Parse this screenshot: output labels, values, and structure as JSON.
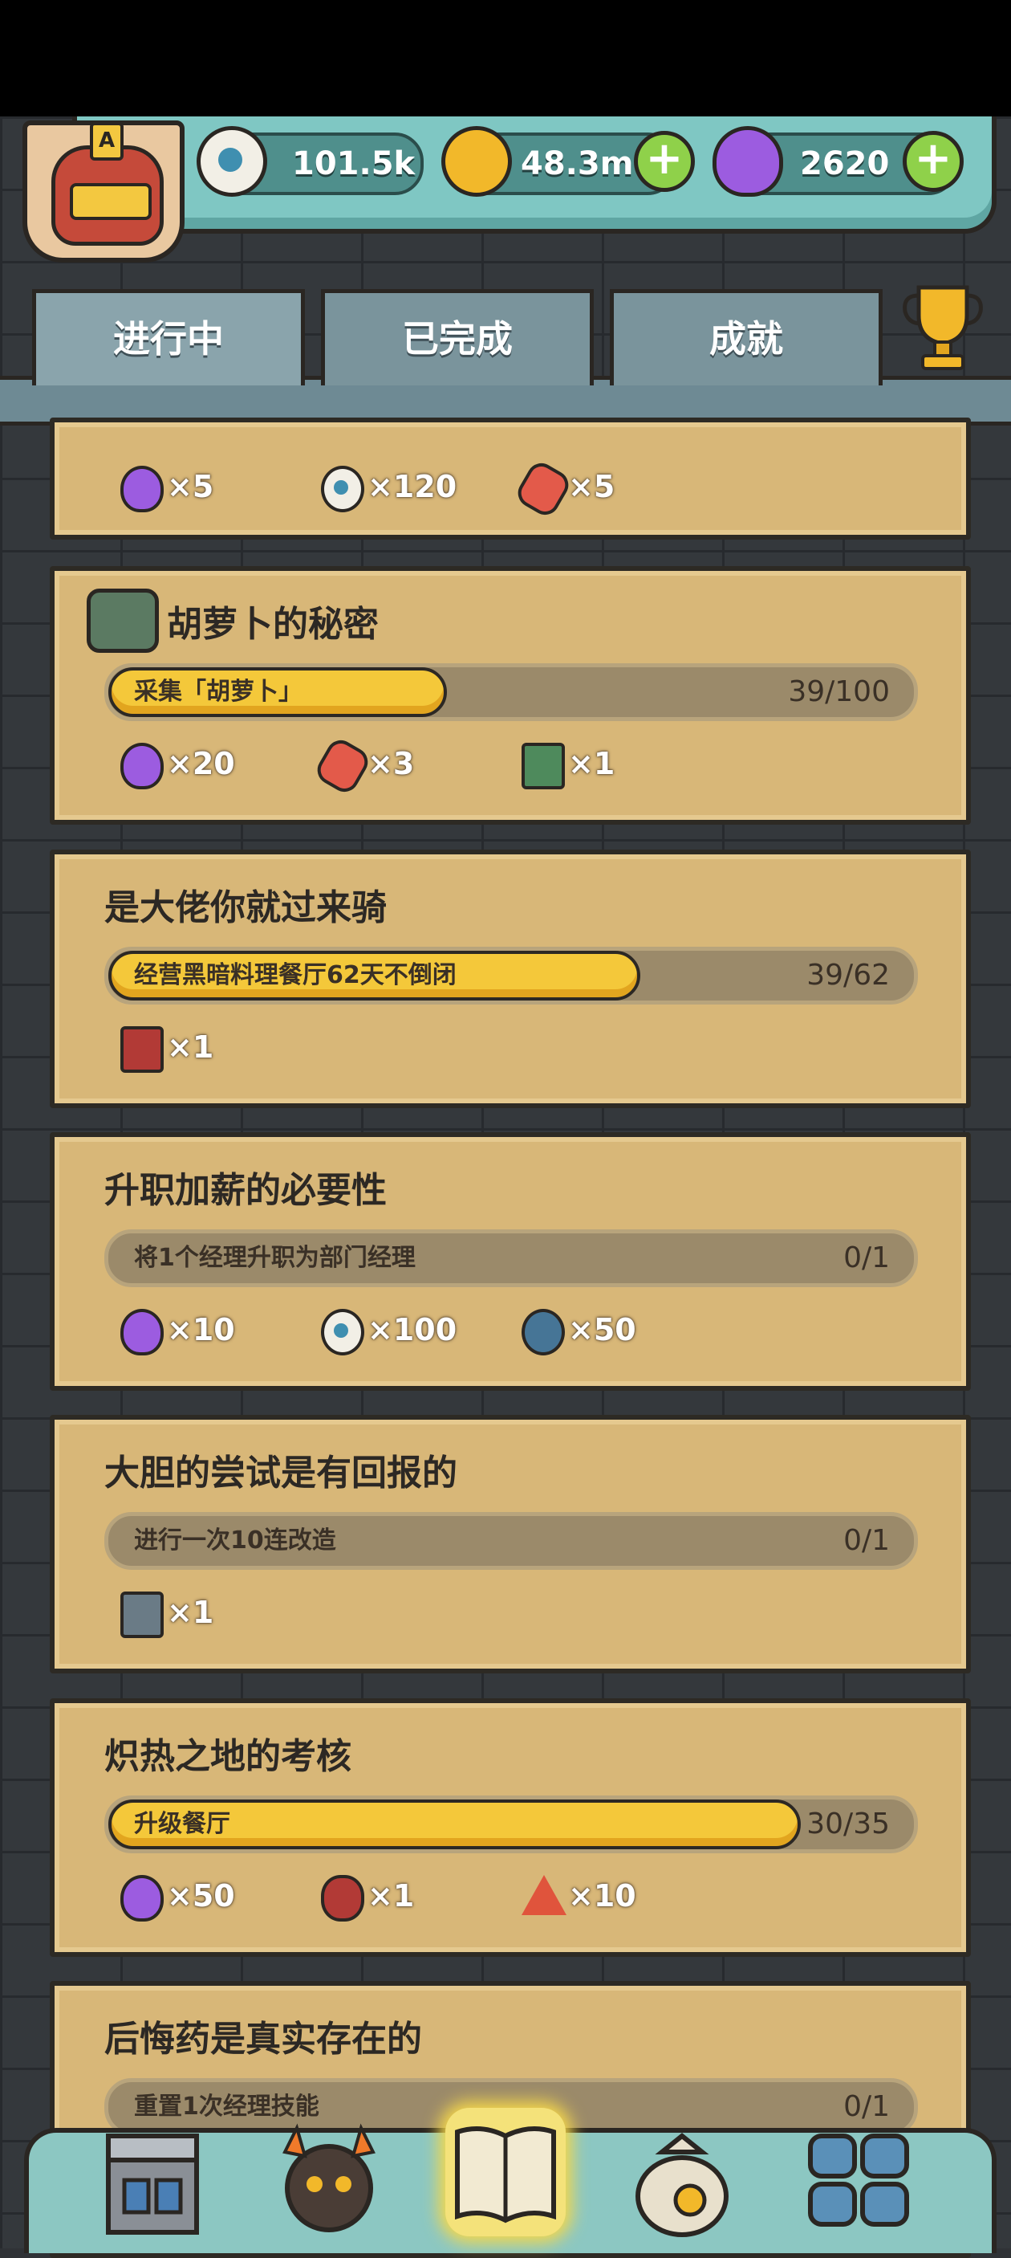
{
  "hud": {
    "eyes": "101.5k",
    "coins": "48.3m",
    "potions": "2620",
    "avatar_badge": "A",
    "plus_label": "+"
  },
  "tabs": [
    {
      "label": "进行中",
      "active": true
    },
    {
      "label": "已完成",
      "active": false
    },
    {
      "label": "成就",
      "active": false
    }
  ],
  "cards": [
    {
      "title": "",
      "progress": null,
      "rewards": [
        {
          "icon": "potion-icon",
          "amount": "×5"
        },
        {
          "icon": "eyeball-icon",
          "amount": "×120"
        },
        {
          "icon": "magnet-icon",
          "amount": "×5"
        }
      ]
    },
    {
      "title": "胡萝卜的秘密",
      "progress": {
        "label": "采集「胡萝卜」",
        "count": "39/100",
        "fraction": 0.39
      },
      "rewards": [
        {
          "icon": "potion-icon",
          "amount": "×20"
        },
        {
          "icon": "magnet-icon",
          "amount": "×3"
        },
        {
          "icon": "circuit-chip-icon",
          "amount": "×1"
        }
      ]
    },
    {
      "title": "是大佬你就过来骑",
      "progress": {
        "label": "经营黑暗料理餐厅62天不倒闭",
        "count": "39/62",
        "fraction": 0.629
      },
      "rewards": [
        {
          "icon": "red-mount-icon",
          "amount": "×1"
        }
      ]
    },
    {
      "title": "升职加薪的必要性",
      "progress": {
        "label": "将1个经理升职为部门经理",
        "count": "0/1",
        "fraction": 0
      },
      "rewards": [
        {
          "icon": "potion-icon",
          "amount": "×10"
        },
        {
          "icon": "eyeball-icon",
          "amount": "×100"
        },
        {
          "icon": "gear-icon",
          "amount": "×50"
        }
      ]
    },
    {
      "title": "大胆的尝试是有回报的",
      "progress": {
        "label": "进行一次10连改造",
        "count": "0/1",
        "fraction": 0
      },
      "rewards": [
        {
          "icon": "machine-icon",
          "amount": "×1"
        }
      ]
    },
    {
      "title": "炽热之地的考核",
      "progress": {
        "label": "升级餐厅",
        "count": "30/35",
        "fraction": 0.857
      },
      "rewards": [
        {
          "icon": "potion-icon",
          "amount": "×50"
        },
        {
          "icon": "red-gem-icon",
          "amount": "×1"
        },
        {
          "icon": "warning-triangle-icon",
          "amount": "×10"
        }
      ]
    },
    {
      "title": "后悔药是真实存在的",
      "progress": {
        "label": "重置1次经理技能",
        "count": "0/1",
        "fraction": 0
      },
      "rewards": []
    }
  ],
  "bottom_nav": [
    {
      "icon": "restaurant-icon"
    },
    {
      "icon": "monster-icon"
    },
    {
      "icon": "quest-book-icon",
      "active": true
    },
    {
      "icon": "money-bag-icon"
    },
    {
      "icon": "grid-menu-icon"
    }
  ]
}
